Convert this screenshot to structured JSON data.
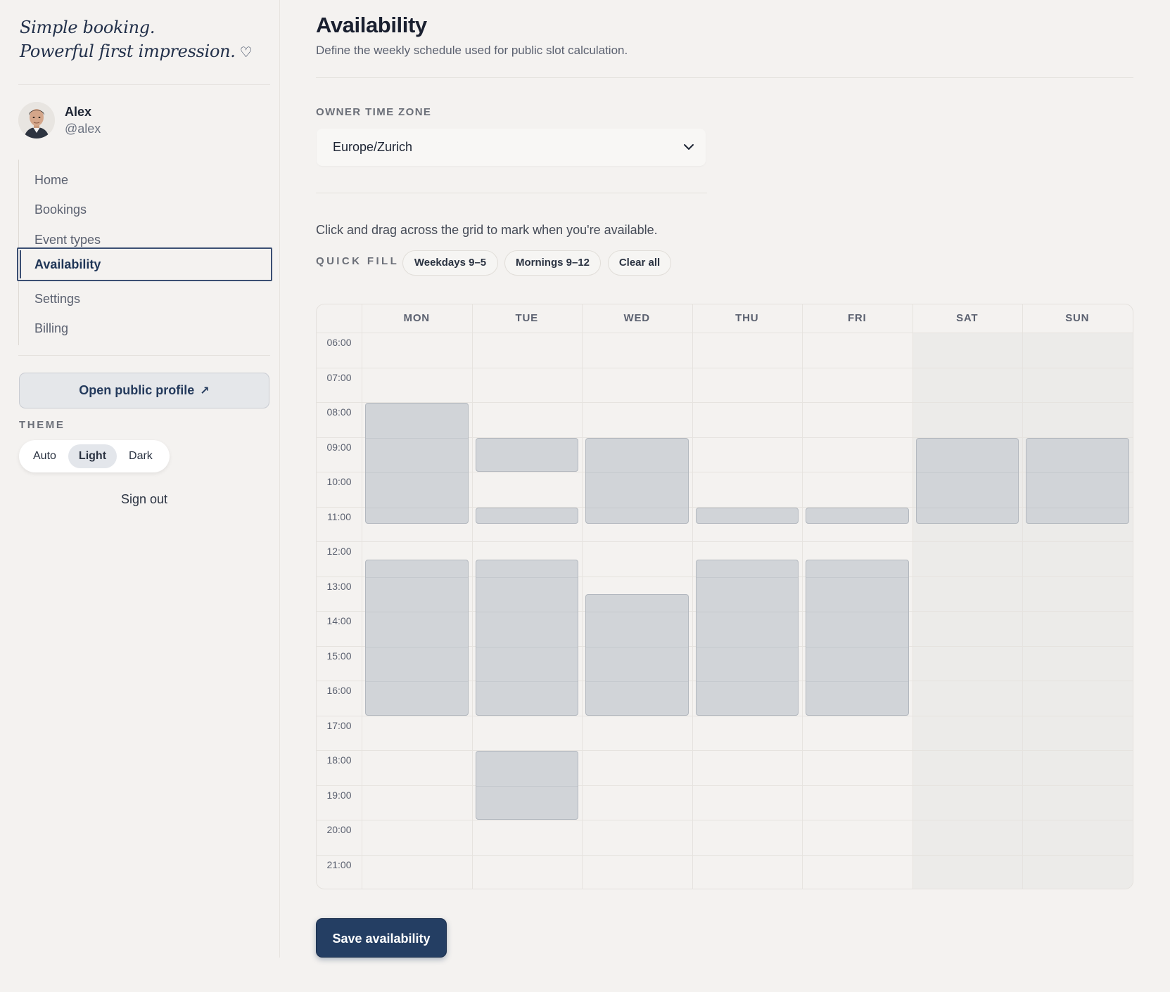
{
  "brand": {
    "line1": "Simple booking.",
    "line2": "Powerful first impression."
  },
  "user": {
    "name": "Alex",
    "handle": "@alex"
  },
  "nav": [
    {
      "label": "Home",
      "active": false
    },
    {
      "label": "Bookings",
      "active": false
    },
    {
      "label": "Event types",
      "active": false
    },
    {
      "label": "Availability",
      "active": true
    },
    {
      "label": "Settings",
      "active": false
    },
    {
      "label": "Billing",
      "active": false
    }
  ],
  "open_profile_label": "Open public profile",
  "theme": {
    "label": "THEME",
    "options": [
      "Auto",
      "Light",
      "Dark"
    ],
    "selected": "Light"
  },
  "sign_out_label": "Sign out",
  "page": {
    "title": "Availability",
    "subtitle": "Define the weekly schedule used for public slot calculation."
  },
  "timezone": {
    "label": "OWNER TIME ZONE",
    "value": "Europe/Zurich"
  },
  "hint": "Click and drag across the grid to mark when you're available.",
  "quick_fill": {
    "label": "QUICK FILL",
    "options": [
      "Weekdays 9–5",
      "Mornings 9–12",
      "Clear all"
    ]
  },
  "schedule": {
    "days": [
      "MON",
      "TUE",
      "WED",
      "THU",
      "FRI",
      "SAT",
      "SUN"
    ],
    "hours": [
      "06:00",
      "07:00",
      "08:00",
      "09:00",
      "10:00",
      "11:00",
      "12:00",
      "13:00",
      "14:00",
      "15:00",
      "16:00",
      "17:00",
      "18:00",
      "19:00",
      "20:00",
      "21:00"
    ],
    "availability": [
      {
        "day": "MON",
        "start": "08:00",
        "end": "11:30"
      },
      {
        "day": "MON",
        "start": "12:30",
        "end": "17:00"
      },
      {
        "day": "TUE",
        "start": "09:00",
        "end": "10:00"
      },
      {
        "day": "TUE",
        "start": "11:00",
        "end": "11:30"
      },
      {
        "day": "TUE",
        "start": "12:30",
        "end": "17:00"
      },
      {
        "day": "TUE",
        "start": "18:00",
        "end": "20:00"
      },
      {
        "day": "WED",
        "start": "09:00",
        "end": "11:30"
      },
      {
        "day": "WED",
        "start": "13:30",
        "end": "17:00"
      },
      {
        "day": "THU",
        "start": "11:00",
        "end": "11:30"
      },
      {
        "day": "THU",
        "start": "12:30",
        "end": "17:00"
      },
      {
        "day": "FRI",
        "start": "11:00",
        "end": "11:30"
      },
      {
        "day": "FRI",
        "start": "12:30",
        "end": "17:00"
      },
      {
        "day": "SAT",
        "start": "09:00",
        "end": "11:30"
      },
      {
        "day": "SUN",
        "start": "09:00",
        "end": "11:30"
      }
    ]
  },
  "save_label": "Save availability",
  "colors": {
    "accent": "#243e63",
    "slot": "#d1d4d8",
    "background": "#f4f2f0"
  },
  "icons": {
    "heart": "heart-icon",
    "external": "external-link-icon",
    "chevron": "chevron-down-icon"
  }
}
